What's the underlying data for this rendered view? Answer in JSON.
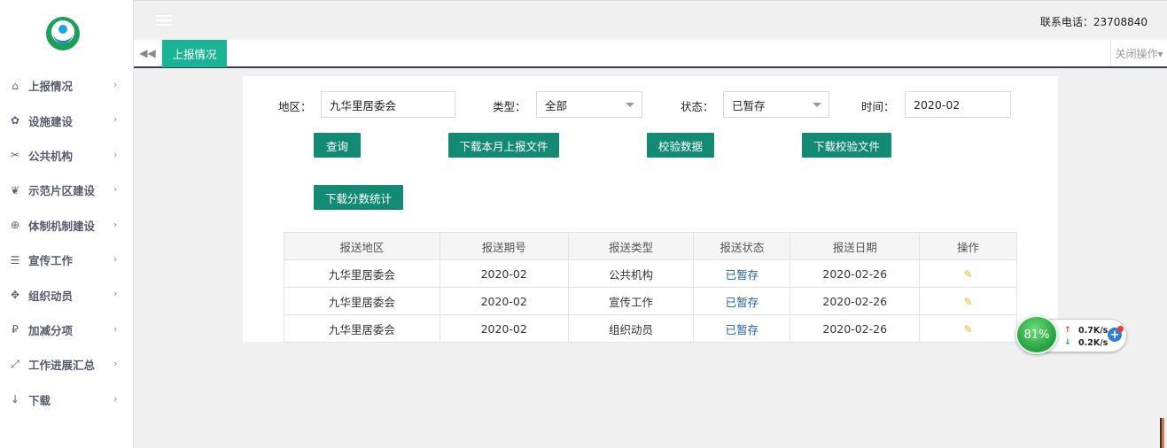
{
  "sidebar": {
    "items": [
      {
        "label": "上报情况",
        "icon": "home-icon",
        "glyph": "⌂"
      },
      {
        "label": "设施建设",
        "icon": "gear-icon",
        "glyph": "✿"
      },
      {
        "label": "公共机构",
        "icon": "scissors-icon",
        "glyph": "✂"
      },
      {
        "label": "示范片区建设",
        "icon": "leaf-icon",
        "glyph": "❦"
      },
      {
        "label": "体制机制建设",
        "icon": "lifebuoy-icon",
        "glyph": "⊕"
      },
      {
        "label": "宣传工作",
        "icon": "list-icon",
        "glyph": "☰"
      },
      {
        "label": "组织动员",
        "icon": "users-icon",
        "glyph": "✥"
      },
      {
        "label": "加减分项",
        "icon": "ruble-icon",
        "glyph": "₽"
      },
      {
        "label": "工作进展汇总",
        "icon": "expand-icon",
        "glyph": "⤢"
      },
      {
        "label": "下载",
        "icon": "download-arrow-icon",
        "glyph": "↓"
      }
    ],
    "arrow": "›"
  },
  "header": {
    "contact": "联系电话：23708840"
  },
  "tabs": {
    "back_glyph": "◀◀",
    "active_label": "上报情况",
    "close_ops": "关闭操作▾"
  },
  "filters": {
    "region_label": "地区：",
    "region_value": "九华里居委会",
    "type_label": "类型：",
    "type_value": "全部",
    "status_label": "状态：",
    "status_value": "已暂存",
    "time_label": "时间：",
    "time_value": "2020-02"
  },
  "buttons": {
    "query": "查询",
    "download_month": "下载本月上报文件",
    "validate": "校验数据",
    "download_validate": "下载校验文件",
    "download_stats": "下载分数统计"
  },
  "table": {
    "headers": [
      "报送地区",
      "报送期号",
      "报送类型",
      "报送状态",
      "报送日期",
      "操作"
    ],
    "rows": [
      {
        "region": "九华里居委会",
        "period": "2020-02",
        "type": "公共机构",
        "status": "已暂存",
        "date": "2020-02-26"
      },
      {
        "region": "九华里居委会",
        "period": "2020-02",
        "type": "宣传工作",
        "status": "已暂存",
        "date": "2020-02-26"
      },
      {
        "region": "九华里居委会",
        "period": "2020-02",
        "type": "组织动员",
        "status": "已暂存",
        "date": "2020-02-26"
      }
    ]
  },
  "speed_widget": {
    "percent": "81%",
    "upload": "0.7K/s",
    "download": "0.2K/s"
  },
  "colors": {
    "accent": "#1ab394",
    "button": "#138a73",
    "link": "#1d5fa8"
  }
}
